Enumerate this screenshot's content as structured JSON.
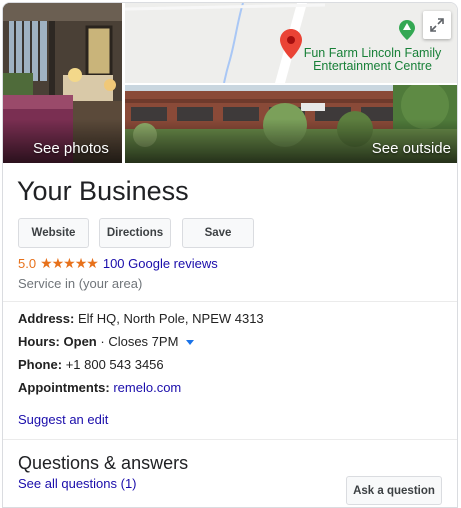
{
  "photos": {
    "interior_label": "See photos",
    "outside_label": "See outside",
    "map_place_name_line1": "Fun Farm Lincoln Family",
    "map_place_name_line2": "Entertainment Centre"
  },
  "business": {
    "name": "Your Business",
    "rating": "5.0",
    "stars": "★★★★★",
    "reviews_link": "100 Google reviews",
    "service_area": "Service in (your area)"
  },
  "actions": {
    "website": "Website",
    "directions": "Directions",
    "save": "Save"
  },
  "details": {
    "address_label": "Address:",
    "address_value": "Elf HQ, North Pole, NPEW 4313",
    "hours_label": "Hours:",
    "hours_status": "Open",
    "hours_rest": "· Closes 7PM",
    "phone_label": "Phone:",
    "phone_value": "+1 800 543 3456",
    "appointments_label": "Appointments:",
    "appointments_link": "remelo.com"
  },
  "suggest_edit": "Suggest an edit",
  "qa": {
    "title": "Questions & answers",
    "see_all": "See all questions (1)",
    "ask_button": "Ask a question"
  },
  "colors": {
    "link": "#1a0dab",
    "rating": "#e7711b",
    "map_place": "#188038",
    "pin": "#ea4335"
  },
  "icons": [
    "expand-icon",
    "map-pin-icon",
    "park-marker-icon",
    "hours-caret-icon",
    "star-icon"
  ]
}
